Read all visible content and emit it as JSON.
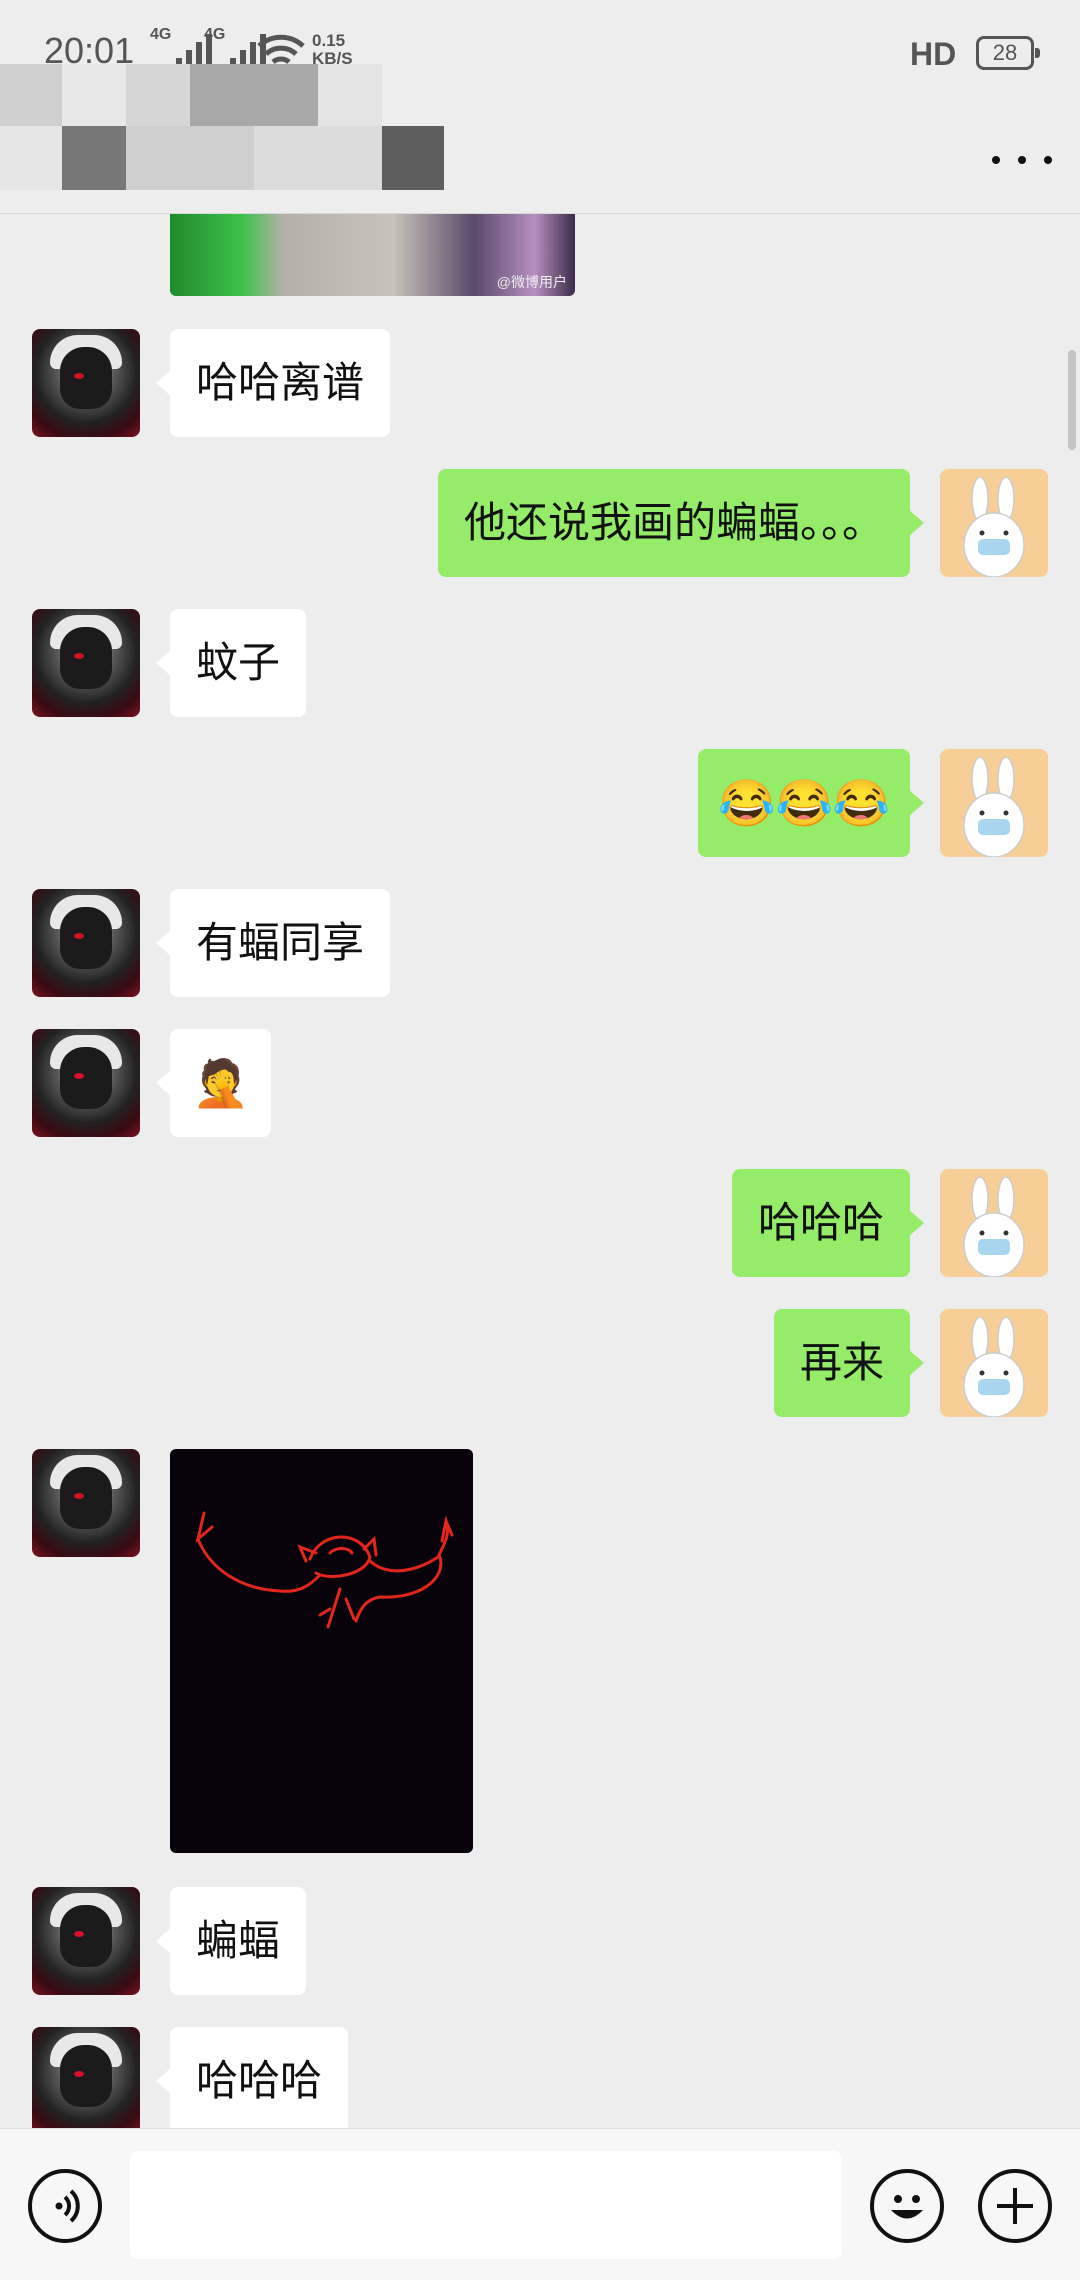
{
  "status_bar": {
    "time": "20:01",
    "network_1": "4G",
    "network_2": "4G",
    "speed_value": "0.15",
    "speed_unit": "KB/S",
    "hd": "HD",
    "battery": "28"
  },
  "header": {
    "more_icon": "more-dots-icon"
  },
  "top_image": {
    "watermark": "@微博用户"
  },
  "messages": [
    {
      "side": "left",
      "text": "哈哈离谱"
    },
    {
      "side": "right",
      "text": "他还说我画的蝙蝠。。。"
    },
    {
      "side": "left",
      "text": "蚊子"
    },
    {
      "side": "right",
      "text": "😂😂😂"
    },
    {
      "side": "left",
      "text": "有蝠同享"
    },
    {
      "side": "left",
      "text": "🤦"
    },
    {
      "side": "right",
      "text": "哈哈哈"
    },
    {
      "side": "right",
      "text": "再来"
    },
    {
      "side": "left",
      "text": "[image: red bat drawing]"
    },
    {
      "side": "left",
      "text": "蝙蝠"
    },
    {
      "side": "left",
      "text": "哈哈哈"
    }
  ],
  "input_bar": {
    "placeholder": "",
    "voice_icon": "voice-icon",
    "emoji_icon": "emoji-icon",
    "plus_icon": "plus-icon"
  },
  "colors": {
    "background": "#ededed",
    "outgoing_bubble": "#95ec69",
    "incoming_bubble": "#ffffff"
  }
}
